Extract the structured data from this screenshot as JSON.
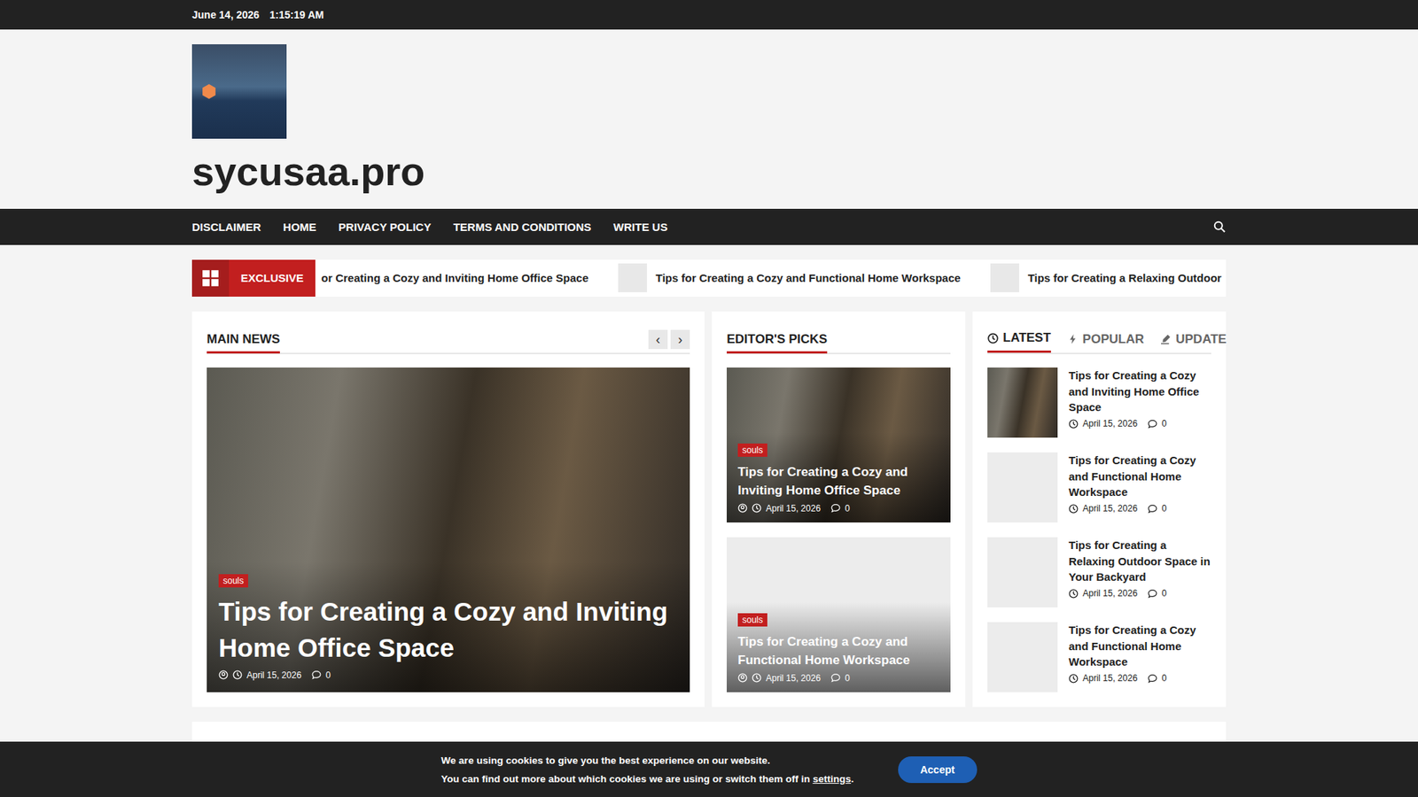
{
  "topbar": {
    "date": "June 14, 2026",
    "time": "1:15:19 AM"
  },
  "site": {
    "title": "sycusaa.pro"
  },
  "nav": {
    "items": [
      "DISCLAIMER",
      "HOME",
      "PRIVACY POLICY",
      "TERMS AND CONDITIONS",
      "WRITE US"
    ]
  },
  "ticker": {
    "label": "EXCLUSIVE",
    "items": [
      {
        "title": "or Creating a Cozy and Inviting Home Office Space",
        "thumb": false
      },
      {
        "title": "Tips for Creating a Cozy and Functional Home Workspace",
        "thumb": true
      },
      {
        "title": "Tips for Creating a Relaxing Outdoor",
        "thumb": true
      }
    ]
  },
  "main_news": {
    "title": "MAIN NEWS",
    "prev": "‹",
    "next": "›",
    "slide": {
      "category": "souls",
      "title": "Tips for Creating a Cozy and Inviting Home Office Space",
      "date": "April 15, 2026",
      "comments": "0",
      "photo": true
    }
  },
  "editors_picks": {
    "title": "EDITOR'S PICKS",
    "cards": [
      {
        "category": "souls",
        "title": "Tips for Creating a Cozy and Inviting Home Office Space",
        "date": "April 15, 2026",
        "comments": "0",
        "photo": true
      },
      {
        "category": "souls",
        "title": "Tips for Creating a Cozy and Functional Home Workspace",
        "date": "April 15, 2026",
        "comments": "0",
        "photo": false
      }
    ]
  },
  "latest": {
    "tabs": [
      {
        "label": "LATEST",
        "icon": "clock",
        "selected": true
      },
      {
        "label": "POPULAR",
        "icon": "bolt",
        "selected": false
      },
      {
        "label": "UPDATE",
        "icon": "pen",
        "selected": false
      }
    ],
    "items": [
      {
        "title": "Tips for Creating a Cozy and Inviting Home Office Space",
        "date": "April 15, 2026",
        "comments": "0",
        "photo": true
      },
      {
        "title": "Tips for Creating a Cozy and Functional Home Workspace",
        "date": "April 15, 2026",
        "comments": "0",
        "photo": false
      },
      {
        "title": "Tips for Creating a Relaxing Outdoor Space in Your Backyard",
        "date": "April 15, 2026",
        "comments": "0",
        "photo": false
      },
      {
        "title": "Tips for Creating a Cozy and Functional Home Workspace",
        "date": "April 15, 2026",
        "comments": "0",
        "photo": false
      }
    ]
  },
  "cookie": {
    "line1": "We are using cookies to give you the best experience on our website.",
    "line2": "You can find out more about which cookies we are using or switch them off in",
    "link": "settings",
    "after_link": ".",
    "button": "Accept"
  }
}
